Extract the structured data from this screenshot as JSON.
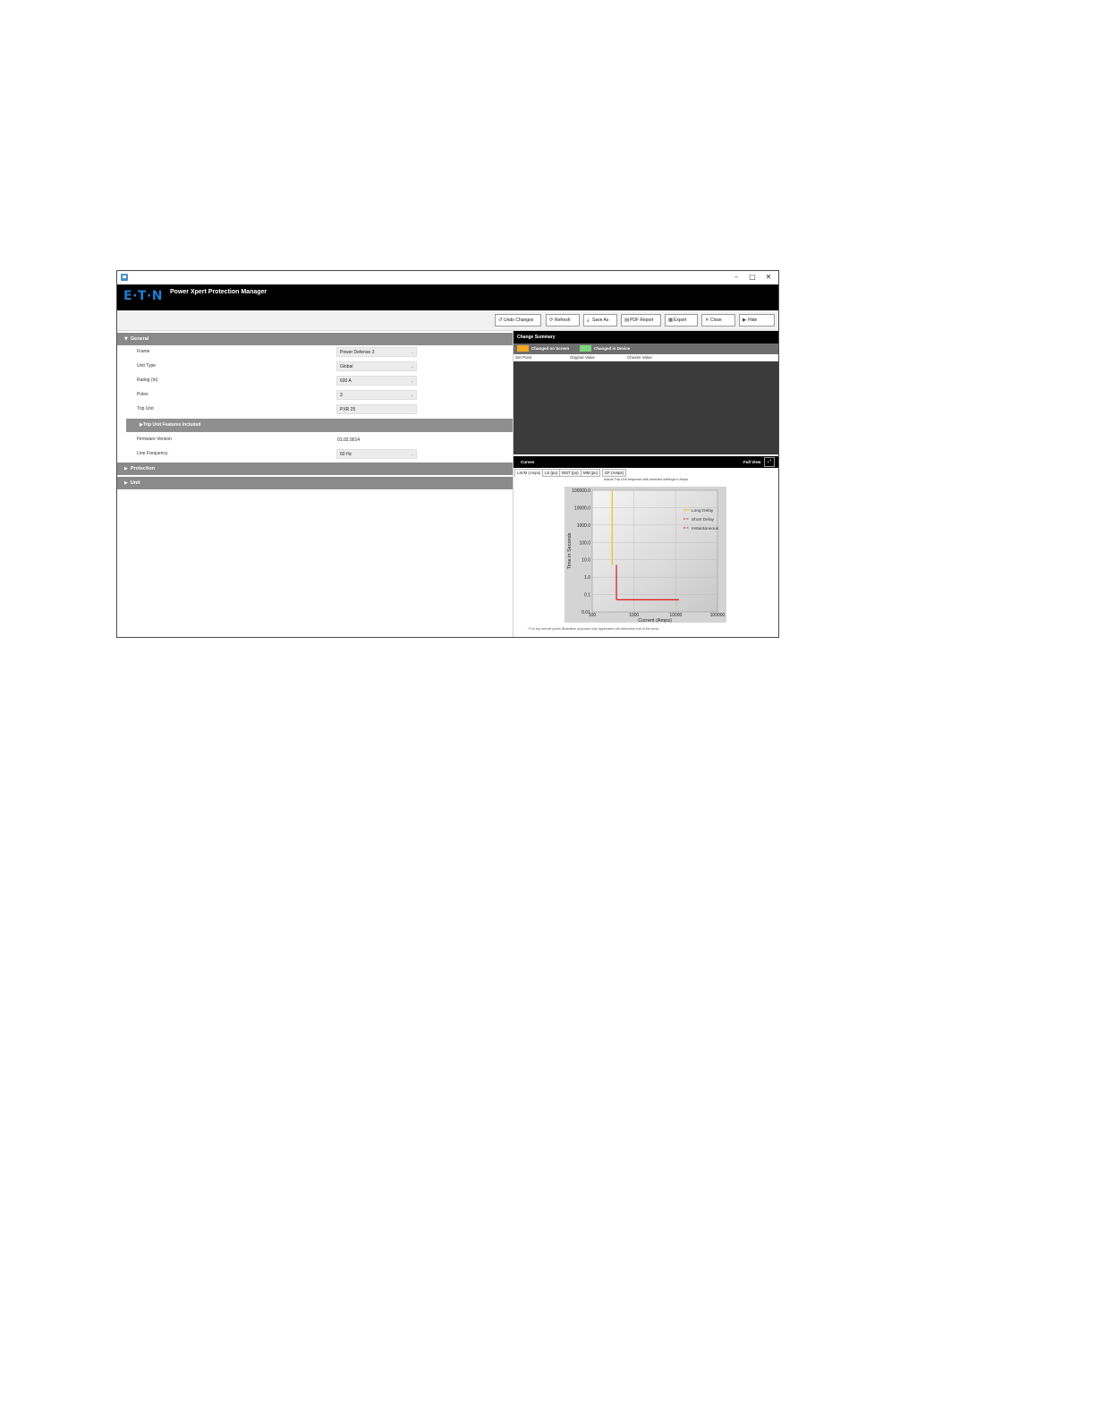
{
  "window": {
    "title_buttons": {
      "minimize": "–",
      "maximize": "□",
      "close": "✕"
    }
  },
  "header": {
    "logo": "E·T·N",
    "app_title": "Power Xpert Protection Manager"
  },
  "toolbar": {
    "undo": "Undo Changes",
    "refresh": "Refresh",
    "save_as": "Save As",
    "pdf_report": "PDF Report",
    "export": "Export",
    "close": "Close",
    "hide": "Hide"
  },
  "general": {
    "title": "General",
    "fields": [
      {
        "label": "Frame",
        "value": "Power Defense 3"
      },
      {
        "label": "Unit Type",
        "value": "Global"
      },
      {
        "label": "Rating (In)",
        "value": "600 A"
      },
      {
        "label": "Poles",
        "value": "3"
      },
      {
        "label": "Trip Unit",
        "value": "PXR 25"
      }
    ],
    "features_title": "Trip Unit Features Included",
    "firmware_label": "Firmware Version",
    "firmware_value": "01.02.0014",
    "line_freq_label": "Line Frequency",
    "line_freq_value": "60 Hz"
  },
  "sections": {
    "protection": "Protection",
    "unit": "Unit"
  },
  "change_summary": {
    "title": "Change Summary",
    "legend_screen": "Changed on Screen",
    "legend_device": "Changed in Device",
    "col_set_point": "Set Point",
    "col_original": "Original Value",
    "col_chosen": "Chosen Value"
  },
  "curves": {
    "title": "Curves",
    "full_view": "Full View",
    "tabs": [
      "LSI/M (Amps)",
      "LS (pu)",
      "INST (pu)",
      "MM (pu)",
      "GF (Amps)"
    ],
    "caption": "Actual Trip Unit response with selected settings in Amps",
    "footnote": "* For trip unit set points illustration purposes only. Application will determine end of the curve."
  },
  "colors": {
    "changed_on_screen": "#f5a623",
    "changed_in_device": "#7ed47e",
    "long_delay": "#f2c218",
    "short_delay": "#e02020",
    "instantaneous": "#e02020"
  },
  "chart_data": {
    "type": "line",
    "x_scale": "log",
    "y_scale": "log",
    "xlabel": "Current (Amps)",
    "ylabel": "Time in Seconds",
    "x_ticks": [
      "100",
      "1000",
      "10000",
      "100000"
    ],
    "y_ticks": [
      "100000.0",
      "10000.0",
      "1000.0",
      "100.0",
      "10.0",
      "1.0",
      "0.1",
      "0.01"
    ],
    "xlim": [
      100,
      100000
    ],
    "ylim": [
      0.01,
      100000
    ],
    "legend_position": "top-right",
    "series": [
      {
        "name": "Long Delay",
        "points": [
          [
            300,
            100000
          ],
          [
            300,
            5
          ]
        ]
      },
      {
        "name": "Short Delay",
        "points": [
          [
            380,
            5
          ],
          [
            380,
            0.05
          ]
        ]
      },
      {
        "name": "Instantaneous",
        "points": [
          [
            380,
            0.05
          ],
          [
            12000,
            0.05
          ]
        ]
      }
    ]
  }
}
